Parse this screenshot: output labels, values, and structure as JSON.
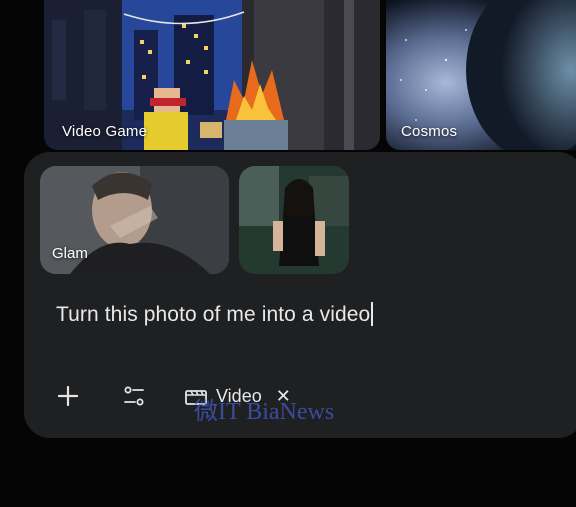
{
  "style_cards": [
    {
      "label": "Video Game"
    },
    {
      "label": "Cosmos"
    }
  ],
  "composer": {
    "attachments": [
      {
        "label": "Glam"
      },
      {
        "label": ""
      }
    ],
    "prompt_text": "Turn this photo of me into a video",
    "toolbar": {
      "add_icon": "plus-icon",
      "tools_icon": "tune-icon",
      "chip": {
        "icon": "clapperboard-icon",
        "label": "Video",
        "close_icon": "close-icon"
      }
    }
  },
  "watermark": "微IT BiaNews"
}
